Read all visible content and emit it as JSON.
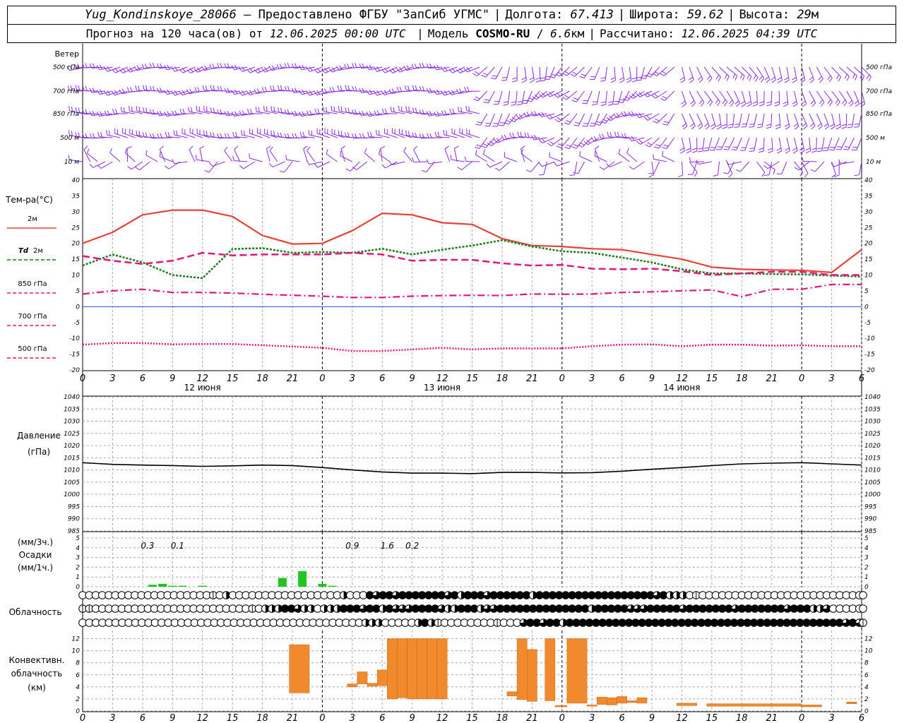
{
  "header": {
    "station": "Yug_Kondinskoye_28066",
    "dash": "—",
    "provider": "Предоставлено ФГБУ \"ЗапСиб УГМС\"",
    "lon_label": "Долгота:",
    "lon_value": "67.413",
    "lat_label": "Широта:",
    "lat_value": "59.62",
    "alt_label": "Высота:",
    "alt_value": "29",
    "alt_unit": "м",
    "forecast_prefix": "Прогноз на 120 часа(ов) от",
    "forecast_time": "12.06.2025 00:00 UTC",
    "model_label": "Модель",
    "model_name": "COSMO-RU",
    "model_res": "6.6",
    "model_res_unit": "км",
    "calc_label": "Рассчитано:",
    "calc_time": "12.06.2025 04:39 UTC"
  },
  "time_axis": {
    "hour_labels": [
      "0",
      "3",
      "6",
      "9",
      "12",
      "15",
      "18",
      "21",
      "0",
      "3",
      "6",
      "9",
      "12",
      "15",
      "18",
      "21",
      "0",
      "3",
      "6",
      "9",
      "12",
      "15",
      "18",
      "21",
      "0",
      "3",
      "6"
    ],
    "day_labels": [
      "12 июня",
      "13 июня",
      "14 июня"
    ]
  },
  "wind_panel": {
    "title": "Ветер",
    "levels": [
      "500 гПа",
      "700 гПа",
      "850 гПа",
      "500 м",
      "10 м"
    ],
    "barb_color": "#8a2be2"
  },
  "temp_panel": {
    "title": "Тем-ра(°С)",
    "yticks": [
      "40",
      "35",
      "30",
      "25",
      "20",
      "15",
      "10",
      "5",
      "0",
      "-5",
      "-10",
      "-15",
      "-20"
    ],
    "legend": [
      {
        "label": "2м",
        "prefix": "",
        "color": "#e8413a"
      },
      {
        "label": "2м",
        "prefix": "Td",
        "color": "#1b7a1b"
      },
      {
        "label": "850 гПа",
        "prefix": "",
        "color": "#e0187a"
      },
      {
        "label": "700 гПа",
        "prefix": "",
        "color": "#e0187a"
      },
      {
        "label": "500 гПа",
        "prefix": "",
        "color": "#e0187a"
      }
    ]
  },
  "pressure_panel": {
    "title": "Давление",
    "unit": "(гПа)",
    "yticks": [
      "1040",
      "1035",
      "1030",
      "1025",
      "1020",
      "1015",
      "1010",
      "1005",
      "1000",
      "995",
      "990",
      "985"
    ]
  },
  "precip_panel": {
    "unit_3h": "(мм/3ч.)",
    "title": "Осадки",
    "unit_1h": "(мм/1ч.)",
    "yticks": [
      "5",
      "4",
      "3",
      "2",
      "1",
      "0"
    ],
    "annotations": [
      "0.3",
      "0.1",
      "0.9",
      "1.6",
      "0.2"
    ],
    "bar_color": "#22c422"
  },
  "cloud_panel": {
    "title": "Облачность"
  },
  "conv_panel": {
    "title_1": "Конвективн.",
    "title_2": "облачность",
    "title_3": "(км)",
    "yticks": [
      "12",
      "10",
      "8",
      "6",
      "4",
      "2",
      "0"
    ],
    "bar_color": "#f08a2c"
  },
  "chart_data": {
    "type": "line",
    "x_hours": [
      0,
      3,
      6,
      9,
      12,
      15,
      18,
      21,
      24,
      27,
      30,
      33,
      36,
      39,
      42,
      45,
      48,
      51,
      54,
      57,
      60,
      63,
      66,
      69,
      72,
      75,
      78
    ],
    "temperature": {
      "ylim": [
        -20,
        40
      ],
      "series": [
        {
          "name": "2м",
          "values": [
            20,
            23.5,
            29,
            30.5,
            30.5,
            28.5,
            22.5,
            19.8,
            20,
            24,
            29.5,
            29,
            26.5,
            26,
            21.5,
            19.3,
            19,
            18.3,
            18,
            16.5,
            15,
            12.5,
            11.8,
            11.6,
            11.5,
            10.8,
            18
          ]
        },
        {
          "name": "Td 2м",
          "values": [
            13,
            16.5,
            14,
            10,
            9,
            18.2,
            18.5,
            17,
            17.3,
            17,
            18.3,
            16.5,
            18,
            19.3,
            21,
            19,
            17.5,
            17,
            15.5,
            14,
            11.8,
            10.5,
            10.5,
            10.3,
            10.2,
            9.8,
            9.5
          ]
        },
        {
          "name": "850 гПа",
          "values": [
            16,
            14.5,
            13.5,
            14.5,
            17,
            16.2,
            16.5,
            16.5,
            16.5,
            17,
            16.5,
            14.5,
            14.8,
            14.8,
            13.7,
            13,
            13.2,
            12,
            11.8,
            12,
            11.2,
            10,
            10.5,
            11,
            11,
            10,
            10
          ]
        },
        {
          "name": "700 гПа",
          "values": [
            4,
            5,
            5.5,
            4.5,
            4.5,
            4.3,
            3.9,
            3.6,
            3.3,
            2.9,
            2.9,
            3.3,
            3.5,
            3.6,
            3.5,
            4,
            3.9,
            4,
            4.5,
            4.7,
            5,
            5.3,
            3.2,
            5.5,
            5.5,
            7,
            7
          ]
        },
        {
          "name": "500 гПа",
          "values": [
            -12,
            -11.5,
            -11.5,
            -11.9,
            -11.8,
            -11.8,
            -12.2,
            -12.6,
            -13,
            -14,
            -14,
            -13.5,
            -13,
            -13.5,
            -13.2,
            -13.2,
            -13.2,
            -12.5,
            -12,
            -11.9,
            -12.5,
            -12,
            -12,
            -12.3,
            -12.2,
            -12.5,
            -12.5
          ]
        }
      ]
    },
    "pressure": {
      "ylim": [
        985,
        1040
      ],
      "values": [
        1013,
        1012.3,
        1012,
        1011.8,
        1011.5,
        1011.7,
        1012,
        1011.8,
        1011,
        1010,
        1009.2,
        1008.7,
        1008.7,
        1008.5,
        1009,
        1009,
        1008.8,
        1008.9,
        1009.5,
        1010.3,
        1011,
        1011.8,
        1012.5,
        1012.8,
        1013,
        1012.5,
        1012
      ]
    },
    "precip": {
      "ylim": [
        0,
        5
      ],
      "bars": [
        {
          "hour": 7,
          "value": 0.2
        },
        {
          "hour": 8,
          "value": 0.3
        },
        {
          "hour": 9,
          "value": 0.1
        },
        {
          "hour": 10,
          "value": 0.1
        },
        {
          "hour": 12,
          "value": 0.1
        },
        {
          "hour": 20,
          "value": 0.9
        },
        {
          "hour": 22,
          "value": 1.6
        },
        {
          "hour": 24,
          "value": 0.3
        },
        {
          "hour": 25,
          "value": 0.1
        }
      ]
    },
    "cloud_cover": {
      "rows": [
        "low",
        "mid",
        "high"
      ],
      "states_per_hour": "0=clear,1=quarter,2=half,3=three-quarter,4=overcast",
      "low": [
        0,
        0,
        0,
        0,
        0,
        0,
        0,
        0,
        0,
        0,
        0,
        0,
        0,
        0,
        0,
        0,
        0,
        0,
        0,
        0,
        1,
        0,
        2,
        0,
        0,
        0,
        0,
        0,
        0,
        0,
        0,
        0,
        0,
        0,
        0,
        0,
        0,
        0,
        0,
        0,
        2,
        0,
        0,
        0,
        4,
        3,
        4,
        4,
        3,
        4,
        4,
        4,
        4,
        4,
        4,
        4,
        3,
        4,
        2,
        4,
        4,
        4,
        3,
        4,
        4,
        4,
        4,
        4,
        4,
        2,
        4,
        4,
        4,
        4,
        4,
        4,
        4,
        4,
        4,
        4,
        4,
        4,
        4,
        4,
        4,
        4,
        4,
        4,
        3,
        4,
        2,
        2,
        2,
        0,
        1,
        0,
        0,
        0,
        0,
        0,
        0,
        0,
        0,
        0,
        0,
        0,
        0,
        0,
        0,
        0,
        0,
        0,
        0,
        0,
        0,
        0,
        0,
        0,
        0,
        0,
        0
      ],
      "mid": [
        1,
        1,
        0,
        0,
        0,
        0,
        0,
        0,
        0,
        0,
        0,
        0,
        0,
        0,
        0,
        0,
        0,
        0,
        0,
        0,
        0,
        0,
        0,
        0,
        0,
        0,
        1,
        0,
        2,
        2,
        2,
        4,
        4,
        3,
        2,
        2,
        0,
        2,
        2,
        2,
        4,
        4,
        4,
        3,
        4,
        4,
        2,
        4,
        3,
        3,
        3,
        4,
        4,
        4,
        4,
        3,
        2,
        2,
        4,
        4,
        4,
        2,
        3,
        3,
        4,
        4,
        4,
        4,
        4,
        4,
        4,
        4,
        4,
        4,
        4,
        4,
        4,
        4,
        2,
        4,
        4,
        4,
        4,
        4,
        3,
        3,
        3,
        4,
        4,
        4,
        4,
        4,
        3,
        4,
        4,
        4,
        4,
        4,
        4,
        4,
        3,
        4,
        4,
        4,
        4,
        4,
        4,
        4,
        3,
        4,
        4,
        4,
        2,
        2,
        3,
        0,
        0,
        0,
        0,
        0,
        0
      ],
      "high": [
        0,
        0,
        0,
        0,
        0,
        0,
        0,
        0,
        0,
        0,
        0,
        0,
        0,
        0,
        0,
        0,
        0,
        0,
        0,
        0,
        0,
        0,
        0,
        0,
        0,
        0,
        0,
        0,
        0,
        0,
        0,
        0,
        0,
        0,
        0,
        0,
        0,
        0,
        0,
        0,
        0,
        0,
        0,
        2,
        2,
        2,
        0,
        0,
        0,
        0,
        0,
        2,
        4,
        2,
        1,
        0,
        0,
        0,
        0,
        0,
        0,
        0,
        0,
        1,
        0,
        0,
        0,
        3,
        4,
        4,
        3,
        4,
        4,
        2,
        4,
        4,
        4,
        4,
        4,
        4,
        4,
        4,
        4,
        4,
        4,
        4,
        4,
        4,
        4,
        4,
        4,
        4,
        4,
        4,
        4,
        4,
        4,
        4,
        4,
        4,
        4,
        4,
        4,
        4,
        4,
        4,
        4,
        4,
        4,
        4,
        4,
        4,
        4,
        4,
        4,
        4,
        3,
        4,
        3,
        1
      ]
    },
    "convective_cloud": {
      "ylim": [
        0,
        13
      ],
      "bars": [
        {
          "from": 20.7,
          "to": 22.7,
          "base": 3,
          "top": 11
        },
        {
          "from": 26.5,
          "to": 27.5,
          "base": 4,
          "top": 4.5
        },
        {
          "from": 27.5,
          "to": 28.5,
          "base": 4.5,
          "top": 6.5
        },
        {
          "from": 28.5,
          "to": 29.5,
          "base": 4.1,
          "top": 4.6
        },
        {
          "from": 29.5,
          "to": 30.5,
          "base": 4.2,
          "top": 6.8
        },
        {
          "from": 30.5,
          "to": 31.5,
          "base": 2,
          "top": 12
        },
        {
          "from": 31.5,
          "to": 32.5,
          "base": 2.2,
          "top": 12
        },
        {
          "from": 32.5,
          "to": 33.5,
          "base": 2,
          "top": 12
        },
        {
          "from": 33.5,
          "to": 34.5,
          "base": 2,
          "top": 12
        },
        {
          "from": 34.5,
          "to": 35.5,
          "base": 2,
          "top": 12
        },
        {
          "from": 35.5,
          "to": 36.5,
          "base": 2,
          "top": 12
        },
        {
          "from": 42.5,
          "to": 43.5,
          "base": 2.5,
          "top": 3.2
        },
        {
          "from": 43.5,
          "to": 44.5,
          "base": 1.9,
          "top": 12
        },
        {
          "from": 44.5,
          "to": 45.5,
          "base": 1.6,
          "top": 10.2
        },
        {
          "from": 46.3,
          "to": 47.3,
          "base": 1.7,
          "top": 12
        },
        {
          "from": 47.3,
          "to": 48.5,
          "base": 0.7,
          "top": 0.9
        },
        {
          "from": 48.5,
          "to": 50.5,
          "base": 1.3,
          "top": 12
        },
        {
          "from": 50.5,
          "to": 51.5,
          "base": 0.8,
          "top": 1
        },
        {
          "from": 51.5,
          "to": 52.5,
          "base": 1.1,
          "top": 2.3
        },
        {
          "from": 52.5,
          "to": 53.5,
          "base": 1,
          "top": 2.2
        },
        {
          "from": 53.5,
          "to": 54.5,
          "base": 1.3,
          "top": 2.4
        },
        {
          "from": 54.5,
          "to": 55.5,
          "base": 1.4,
          "top": 1.7
        },
        {
          "from": 55.5,
          "to": 56.5,
          "base": 1.3,
          "top": 2.2
        },
        {
          "from": 59.5,
          "to": 61.5,
          "base": 0.9,
          "top": 1.3
        },
        {
          "from": 62.5,
          "to": 72,
          "base": 0.8,
          "top": 1.2
        },
        {
          "from": 72,
          "to": 74,
          "base": 0.7,
          "top": 1
        },
        {
          "from": 76.5,
          "to": 77.5,
          "base": 1.2,
          "top": 1.5
        }
      ]
    }
  }
}
